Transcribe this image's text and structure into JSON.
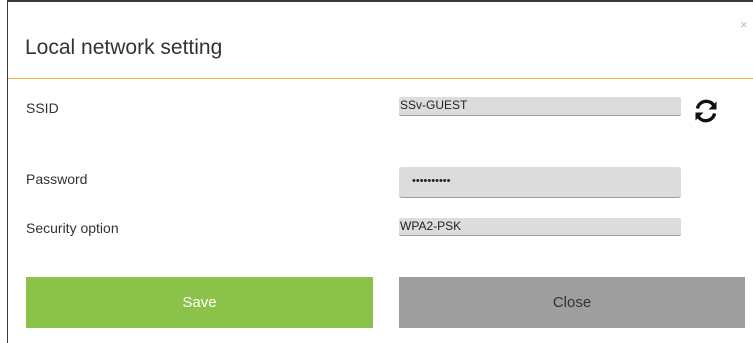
{
  "modal": {
    "title": "Local network setting",
    "close_glyph": "×"
  },
  "fields": {
    "ssid": {
      "label": "SSID",
      "value": "SSv-GUEST"
    },
    "password": {
      "label": "Password",
      "value": "••••••••••"
    },
    "security": {
      "label": "Security option",
      "value": "WPA2-PSK"
    }
  },
  "icons": {
    "refresh": "refresh-icon"
  },
  "buttons": {
    "save_label": "Save",
    "close_label": "Close"
  },
  "colors": {
    "accent_rule": "#f2b13c",
    "save_button": "#8bc34a",
    "close_button": "#9e9e9e",
    "field_background": "#dcdcdc"
  }
}
